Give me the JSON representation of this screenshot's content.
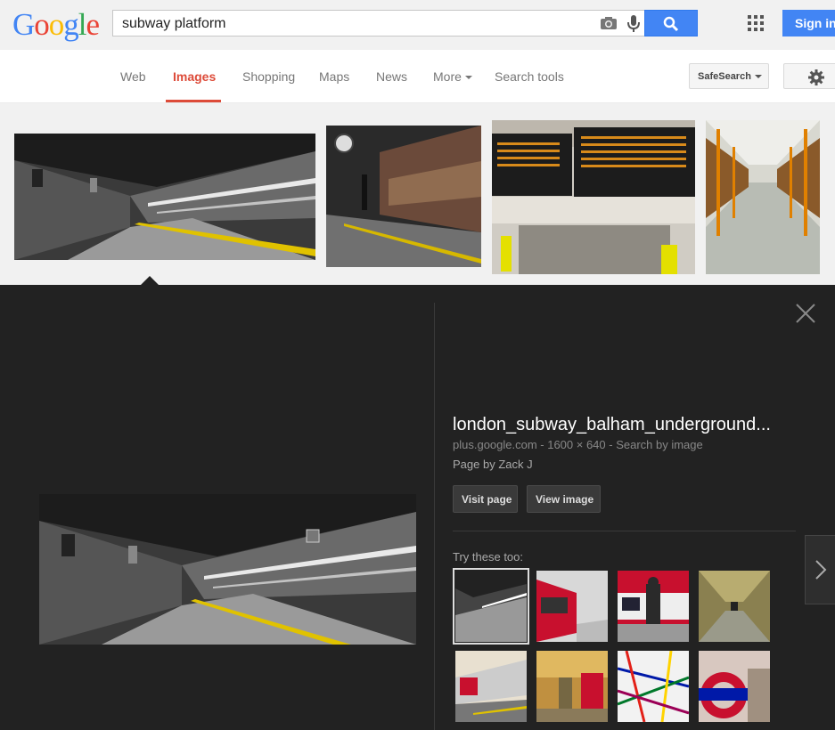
{
  "header": {
    "logo_letters": [
      {
        "ch": "G",
        "color": "#4285f4"
      },
      {
        "ch": "o",
        "color": "#ea4335"
      },
      {
        "ch": "o",
        "color": "#fbbc05"
      },
      {
        "ch": "g",
        "color": "#4285f4"
      },
      {
        "ch": "l",
        "color": "#34a853"
      },
      {
        "ch": "e",
        "color": "#ea4335"
      }
    ],
    "query": "subway platform",
    "signin_label": "Sign in",
    "accent": "#4285f4"
  },
  "nav": {
    "tabs": [
      {
        "label": "Web",
        "active": false
      },
      {
        "label": "Images",
        "active": true
      },
      {
        "label": "Shopping",
        "active": false
      },
      {
        "label": "Maps",
        "active": false
      },
      {
        "label": "News",
        "active": false
      },
      {
        "label": "More",
        "active": false
      },
      {
        "label": "Search tools",
        "active": false
      }
    ],
    "safesearch_label": "SafeSearch",
    "active_color": "#dd4b39"
  },
  "detail": {
    "title": "london_subway_balham_underground...",
    "meta": "plus.google.com - 1600 × 640 - Search by image",
    "page_by": "Page by Zack J",
    "visit_label": "Visit page",
    "view_label": "View image",
    "try_label": "Try these too:"
  }
}
